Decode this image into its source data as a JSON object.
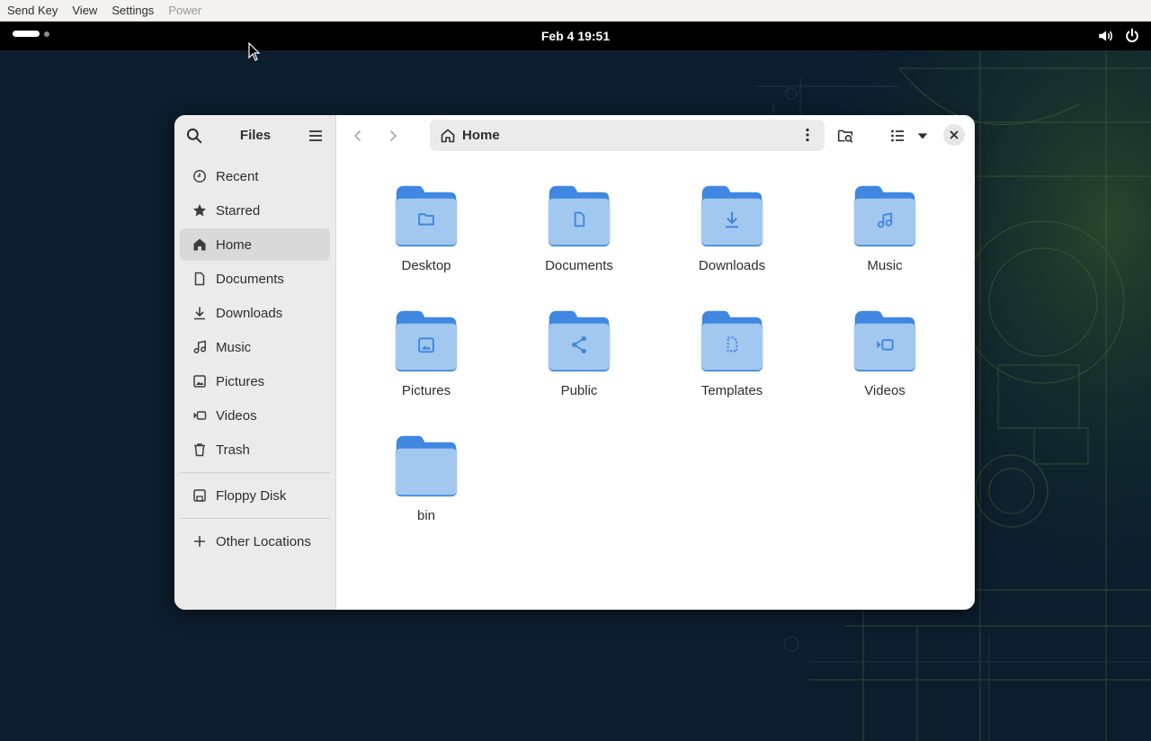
{
  "vm_menu": {
    "items": [
      {
        "label": "Send Key",
        "disabled": false
      },
      {
        "label": "View",
        "disabled": false
      },
      {
        "label": "Settings",
        "disabled": false
      },
      {
        "label": "Power",
        "disabled": true
      }
    ]
  },
  "topbar": {
    "clock": "Feb 4  19:51",
    "tray_icons": [
      "volume-icon",
      "power-icon"
    ]
  },
  "files": {
    "title": "Files",
    "sidebar": {
      "places": [
        {
          "label": "Recent",
          "icon": "clock-icon"
        },
        {
          "label": "Starred",
          "icon": "star-icon"
        },
        {
          "label": "Home",
          "icon": "home-icon",
          "active": true
        },
        {
          "label": "Documents",
          "icon": "document-icon"
        },
        {
          "label": "Downloads",
          "icon": "download-icon"
        },
        {
          "label": "Music",
          "icon": "music-icon"
        },
        {
          "label": "Pictures",
          "icon": "picture-icon"
        },
        {
          "label": "Videos",
          "icon": "video-icon"
        },
        {
          "label": "Trash",
          "icon": "trash-icon"
        }
      ],
      "devices": [
        {
          "label": "Floppy Disk",
          "icon": "floppy-icon"
        }
      ],
      "other": [
        {
          "label": "Other Locations",
          "icon": "plus-icon"
        }
      ]
    },
    "location": "Home",
    "folders": [
      {
        "name": "Desktop",
        "emblem": "folder"
      },
      {
        "name": "Documents",
        "emblem": "document"
      },
      {
        "name": "Downloads",
        "emblem": "download"
      },
      {
        "name": "Music",
        "emblem": "music"
      },
      {
        "name": "Pictures",
        "emblem": "picture"
      },
      {
        "name": "Public",
        "emblem": "share"
      },
      {
        "name": "Templates",
        "emblem": "template"
      },
      {
        "name": "Videos",
        "emblem": "video"
      },
      {
        "name": "bin",
        "emblem": "none"
      }
    ]
  },
  "colors": {
    "folder_back": "#3f87e0",
    "folder_front": "#a3c8f0",
    "folder_emblem": "#3f87e0",
    "desktop_bg": "#0c1d2d",
    "sidebar_bg": "#ebebeb"
  }
}
